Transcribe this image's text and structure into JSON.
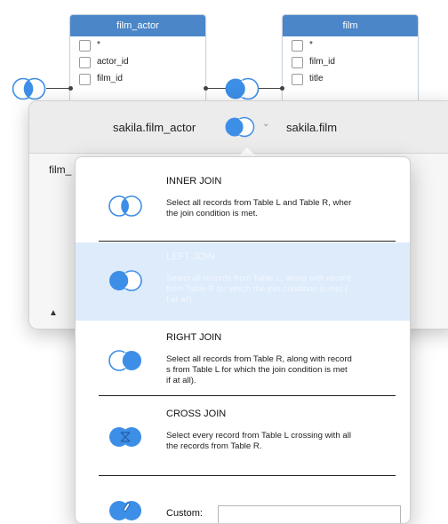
{
  "diagram": {
    "left_table": {
      "name": "film_actor",
      "columns": [
        "*",
        "actor_id",
        "film_id"
      ]
    },
    "right_table": {
      "name": "film",
      "columns": [
        "*",
        "film_id",
        "title"
      ]
    }
  },
  "popover": {
    "left_table_label": "sakila.film_actor",
    "right_table_label": "sakila.film",
    "chevron": "⌄",
    "side_fragment": "film_",
    "up_arrow": "▲"
  },
  "join_menu": {
    "options": [
      {
        "title": "INNER JOIN",
        "description": "Select all records from Table L and Table R, wher\n the join condition is met.",
        "icon": "inner-join-icon"
      },
      {
        "title": "LEFT JOIN",
        "description": "Select all records from Table L, along with record\n from Table R for which the join condition is met (\nf at all).",
        "icon": "left-join-icon",
        "selected": true
      },
      {
        "title": "RIGHT JOIN",
        "description": "Select all records from Table R, along with record\ns from Table L for which the join condition is met\nif at all).",
        "icon": "right-join-icon"
      },
      {
        "title": "CROSS JOIN",
        "description": "Select every record from Table L crossing with all\nthe records from Table R.",
        "icon": "cross-join-icon"
      }
    ],
    "custom_label": "Custom:",
    "custom_value": ""
  },
  "colors": {
    "accent": "#4a86c8",
    "join_fill": "#3d8ee6",
    "selected_bg": "#ddebfb"
  }
}
